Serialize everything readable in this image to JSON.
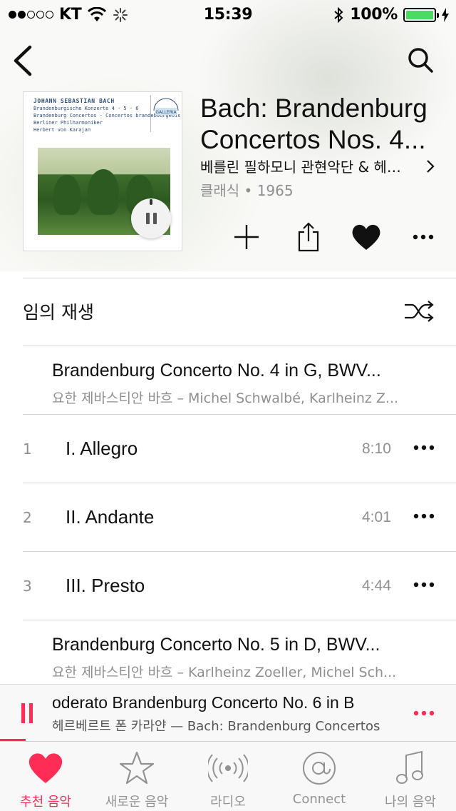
{
  "status_bar": {
    "carrier": "KT",
    "time": "15:39",
    "battery": "100%"
  },
  "album": {
    "title_line1": "Bach: Brandenburg",
    "title_line2": "Concertos Nos. 4...",
    "artist": "베를린 필하모니 관현악단 & 헤르…",
    "genre_year": "클래식 • 1965",
    "cover": {
      "composer": "JOHANN SEBASTIAN BACH",
      "line1": "Brandenburgische Konzerte 4 · 5 · 6",
      "line2": "Brandenburg Concertos · Concertos brandebourgeois",
      "line3": "Berliner Philharmoniker",
      "line4": "Herbert von Karajan",
      "badge": "GALLERIA"
    }
  },
  "shuffle": {
    "label": "임의 재생"
  },
  "works": [
    {
      "title": "Brandenburg Concerto No. 4 in G, BWV...",
      "subtitle": "요한 제바스티안 바흐 – Michel Schwalbé, Karlheinz Z..."
    },
    {
      "title": "Brandenburg Concerto No. 5 in D, BWV...",
      "subtitle": "요한 제바스티안 바흐 – Karlheinz Zoeller, Michel Sch..."
    }
  ],
  "tracks": [
    {
      "number": "1",
      "name": "I. Allegro",
      "duration": "8:10"
    },
    {
      "number": "2",
      "name": "II. Andante",
      "duration": "4:01"
    },
    {
      "number": "3",
      "name": "III. Presto",
      "duration": "4:44"
    }
  ],
  "mini_player": {
    "title": "oderato    Brandenburg Concerto No. 6 in B",
    "subtitle": "헤르베르트 폰 카라얀 — Bach: Brandenburg Concertos"
  },
  "tabs": [
    {
      "label": "추천 음악",
      "icon": "heart-icon",
      "active": true
    },
    {
      "label": "새로운 음악",
      "icon": "star-icon",
      "active": false
    },
    {
      "label": "라디오",
      "icon": "radio-icon",
      "active": false
    },
    {
      "label": "Connect",
      "icon": "at-icon",
      "active": false
    },
    {
      "label": "나의 음악",
      "icon": "music-note-icon",
      "active": false
    }
  ],
  "colors": {
    "accent": "#ff2d55",
    "secondary_text": "#8e8e93",
    "battery": "#4cd964"
  }
}
